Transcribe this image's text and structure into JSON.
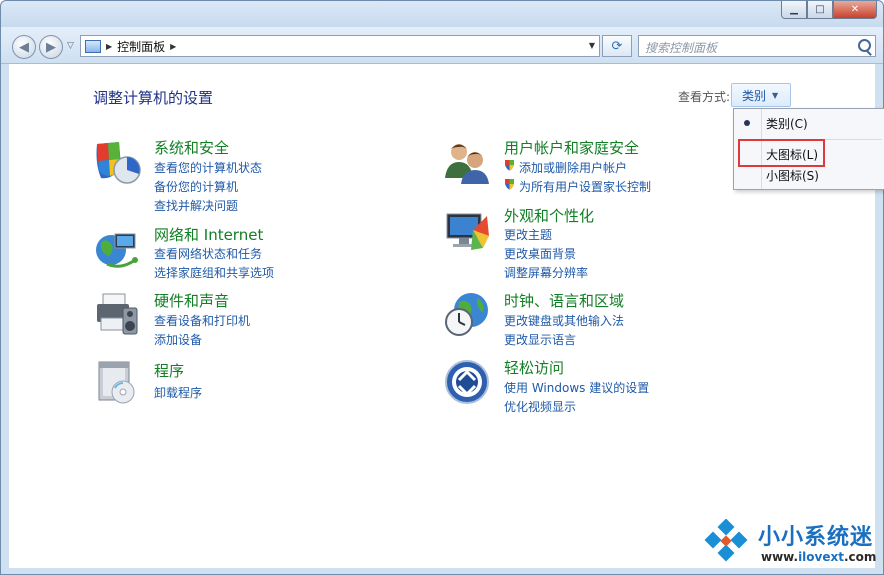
{
  "window": {
    "minimize_glyph": "▁",
    "maximize_glyph": "□",
    "close_glyph": "✕"
  },
  "nav": {
    "back_glyph": "◀",
    "forward_glyph": "▶",
    "recent_glyph": "▽",
    "breadcrumb": [
      "控制面板"
    ],
    "dropdown_glyph": "▼",
    "refresh_glyph": "⟳",
    "search_placeholder": "搜索控制面板"
  },
  "page": {
    "title": "调整计算机的设置",
    "view_by_label": "查看方式:",
    "view_by_value": "类别",
    "view_by_caret": "▼"
  },
  "view_menu": {
    "items": [
      "类别(C)",
      "大图标(L)",
      "小图标(S)"
    ],
    "selected": "类别(C)"
  },
  "categories": [
    {
      "title": "系统和安全",
      "icon": "system-security-icon",
      "links": [
        "查看您的计算机状态",
        "备份您的计算机",
        "查找并解决问题"
      ]
    },
    {
      "title": "网络和 Internet",
      "icon": "network-icon",
      "links": [
        "查看网络状态和任务",
        "选择家庭组和共享选项"
      ]
    },
    {
      "title": "硬件和声音",
      "icon": "hardware-sound-icon",
      "links": [
        "查看设备和打印机",
        "添加设备"
      ]
    },
    {
      "title": "程序",
      "icon": "programs-icon",
      "links": [
        "卸载程序"
      ]
    },
    {
      "title": "用户帐户和家庭安全",
      "icon": "user-accounts-icon",
      "links": [
        "添加或删除用户帐户",
        "为所有用户设置家长控制"
      ]
    },
    {
      "title": "外观和个性化",
      "icon": "appearance-icon",
      "links": [
        "更改主题",
        "更改桌面背景",
        "调整屏幕分辨率"
      ]
    },
    {
      "title": "时钟、语言和区域",
      "icon": "clock-language-icon",
      "links": [
        "更改键盘或其他输入法",
        "更改显示语言"
      ]
    },
    {
      "title": "轻松访问",
      "icon": "ease-of-access-icon",
      "links": [
        "使用 Windows 建议的设置",
        "优化视频显示"
      ]
    }
  ],
  "watermark": {
    "name": "小小系统迷",
    "url_prefix": "www.",
    "url_domain": "ilovext",
    "url_suffix": ".com"
  },
  "colors": {
    "category_title": "#117f24",
    "link": "#1f5aa8",
    "page_title": "#1e3287",
    "highlight": "#e0393b"
  }
}
